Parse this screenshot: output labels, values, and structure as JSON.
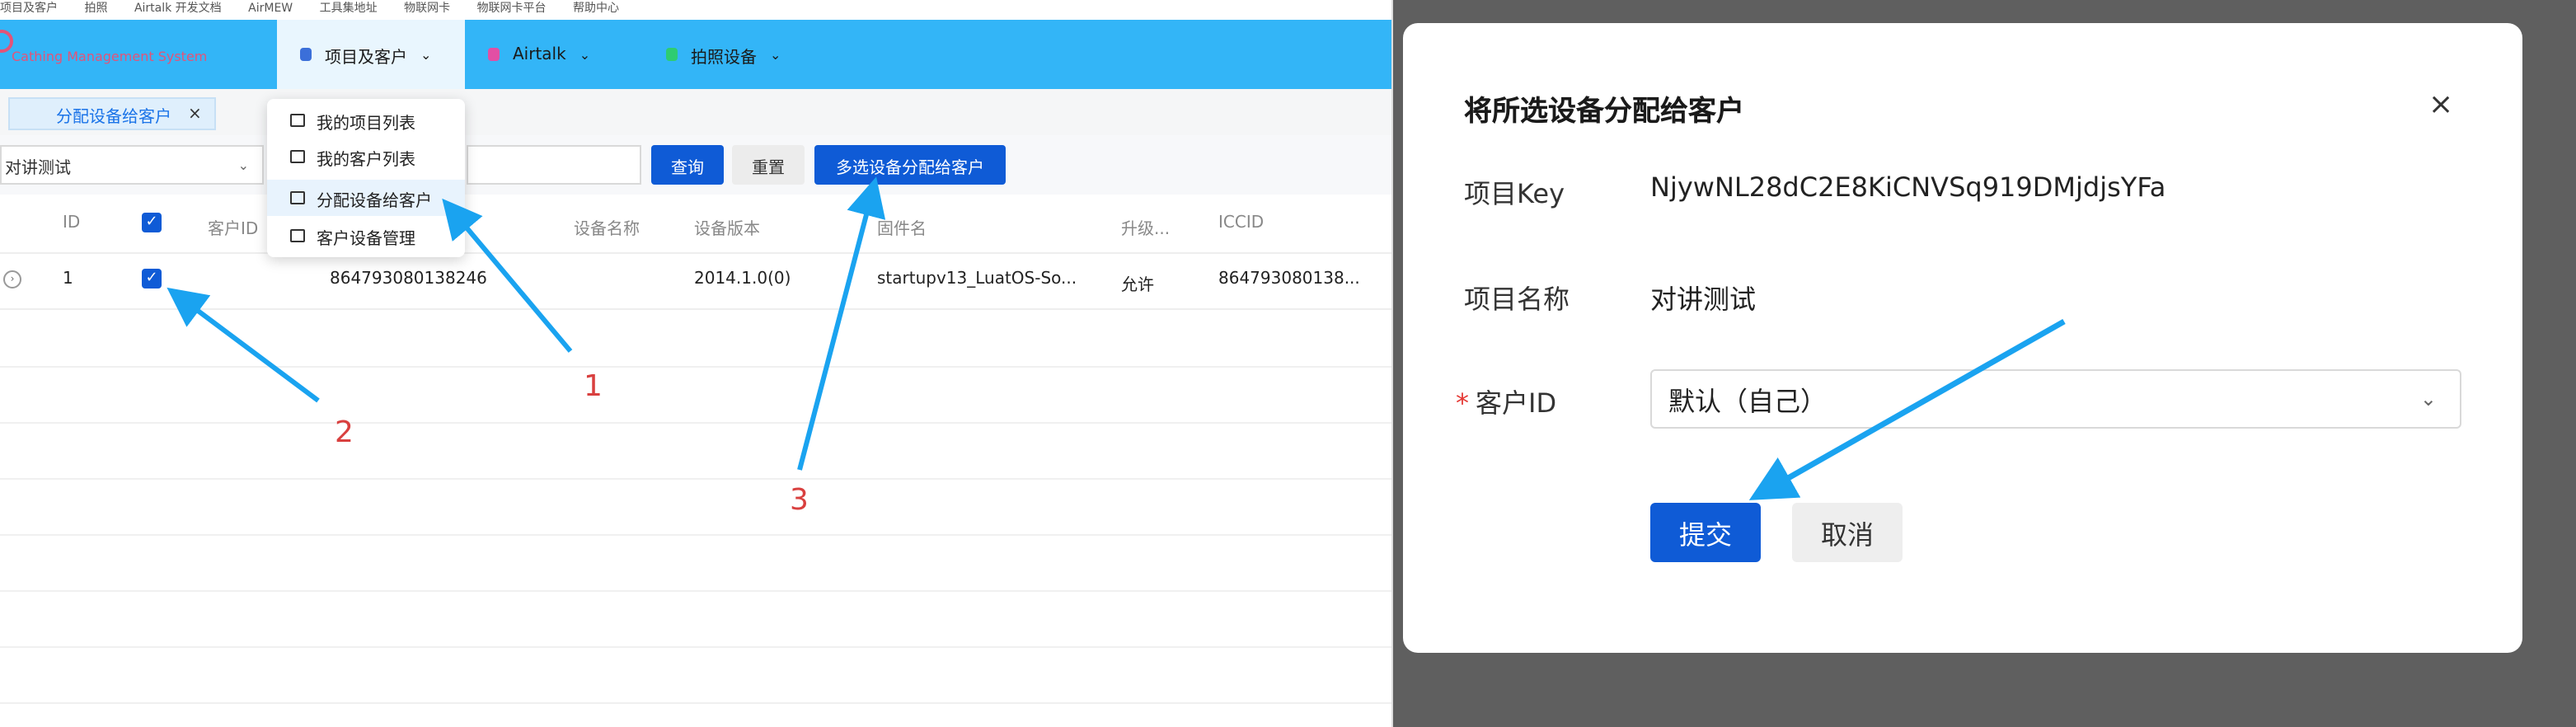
{
  "bookmarks": [
    "项目及客户",
    "拍照",
    "Airtalk 开发文档",
    "AirMEW",
    "工具集地址",
    "物联网卡",
    "物联网卡平台",
    "帮助中心"
  ],
  "left": {
    "logo_text": "Cathing Management System",
    "menus": [
      {
        "label": "项目及客户",
        "icon": "shield-icon"
      },
      {
        "label": "Airtalk",
        "icon": "airtalk-icon"
      },
      {
        "label": "拍照设备",
        "icon": "camera-icon"
      }
    ],
    "tab": {
      "label": "分配设备给客户",
      "close": "×"
    },
    "filter_select": {
      "value": "对讲测试"
    },
    "buttons": {
      "query": "查询",
      "reset": "重置",
      "assign_multi": "多选设备分配给客户"
    },
    "dropdown": [
      {
        "label": "我的项目列表"
      },
      {
        "label": "我的客户列表"
      },
      {
        "label": "分配设备给客户"
      },
      {
        "label": "客户设备管理"
      }
    ],
    "table": {
      "headers": [
        "ID",
        "客户ID",
        "设备名称",
        "设备版本",
        "固件名",
        "升级...",
        "ICCID"
      ],
      "rows": [
        {
          "id": "1",
          "imei": "864793080138246",
          "version": "2014.1.0(0)",
          "firmware": "startupv13_LuatOS-So...",
          "upgrade": "允许",
          "iccid": "864793080138..."
        }
      ]
    },
    "annotations": [
      "1",
      "2",
      "3"
    ]
  },
  "dialog": {
    "title": "将所选设备分配给客户",
    "close": "×",
    "fields": {
      "project_key_label": "项目Key",
      "project_key_value": "NjywNL28dC2E8KiCNVSq919DMjdjsYFa",
      "project_name_label": "项目名称",
      "project_name_value": "对讲测试",
      "customer_id_label": "客户ID",
      "customer_id_value": "默认（自己）"
    },
    "buttons": {
      "submit": "提交",
      "cancel": "取消"
    }
  }
}
